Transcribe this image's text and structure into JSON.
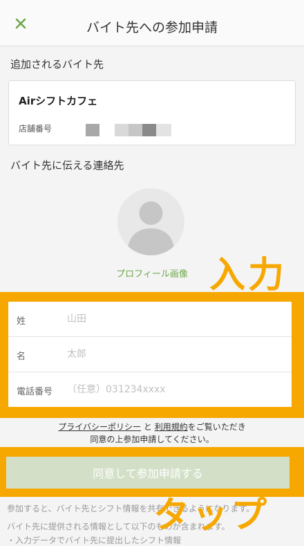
{
  "header": {
    "title": "バイト先への参加申請",
    "close_icon_color": "#6ea74a"
  },
  "shop_section": {
    "label": "追加されるバイト先",
    "shop_name": "Airシフトカフェ",
    "store_number_label": "店舗番号"
  },
  "contact_section": {
    "label": "バイト先に伝える連絡先",
    "profile_image_link": "プロフィール画像"
  },
  "form": {
    "last_name": {
      "label": "姓",
      "placeholder": "山田"
    },
    "first_name": {
      "label": "名",
      "placeholder": "太郎"
    },
    "phone": {
      "label": "電話番号",
      "placeholder": "（任意）031234xxxx"
    }
  },
  "agreement": {
    "privacy_link": "プライバシーポリシー",
    "and": " と ",
    "terms_link": "利用規約",
    "tail1": "をご覧いただき",
    "line2": "同意の上参加申請してください。"
  },
  "submit_label": "同意して参加申請する",
  "footnotes": {
    "line1": "参加すると、バイト先とシフト情報を共有できるようになります。",
    "line2": "バイト先に提供される情報として以下のものが含まれます。",
    "line3": "・入力データでバイト先に提出したシフト情報"
  },
  "annotations": {
    "input": "入力",
    "tap": "タップ"
  },
  "colors": {
    "accent": "#f7a800",
    "brand_green": "#6ea74a",
    "disabled_button": "#d3e0c7"
  }
}
